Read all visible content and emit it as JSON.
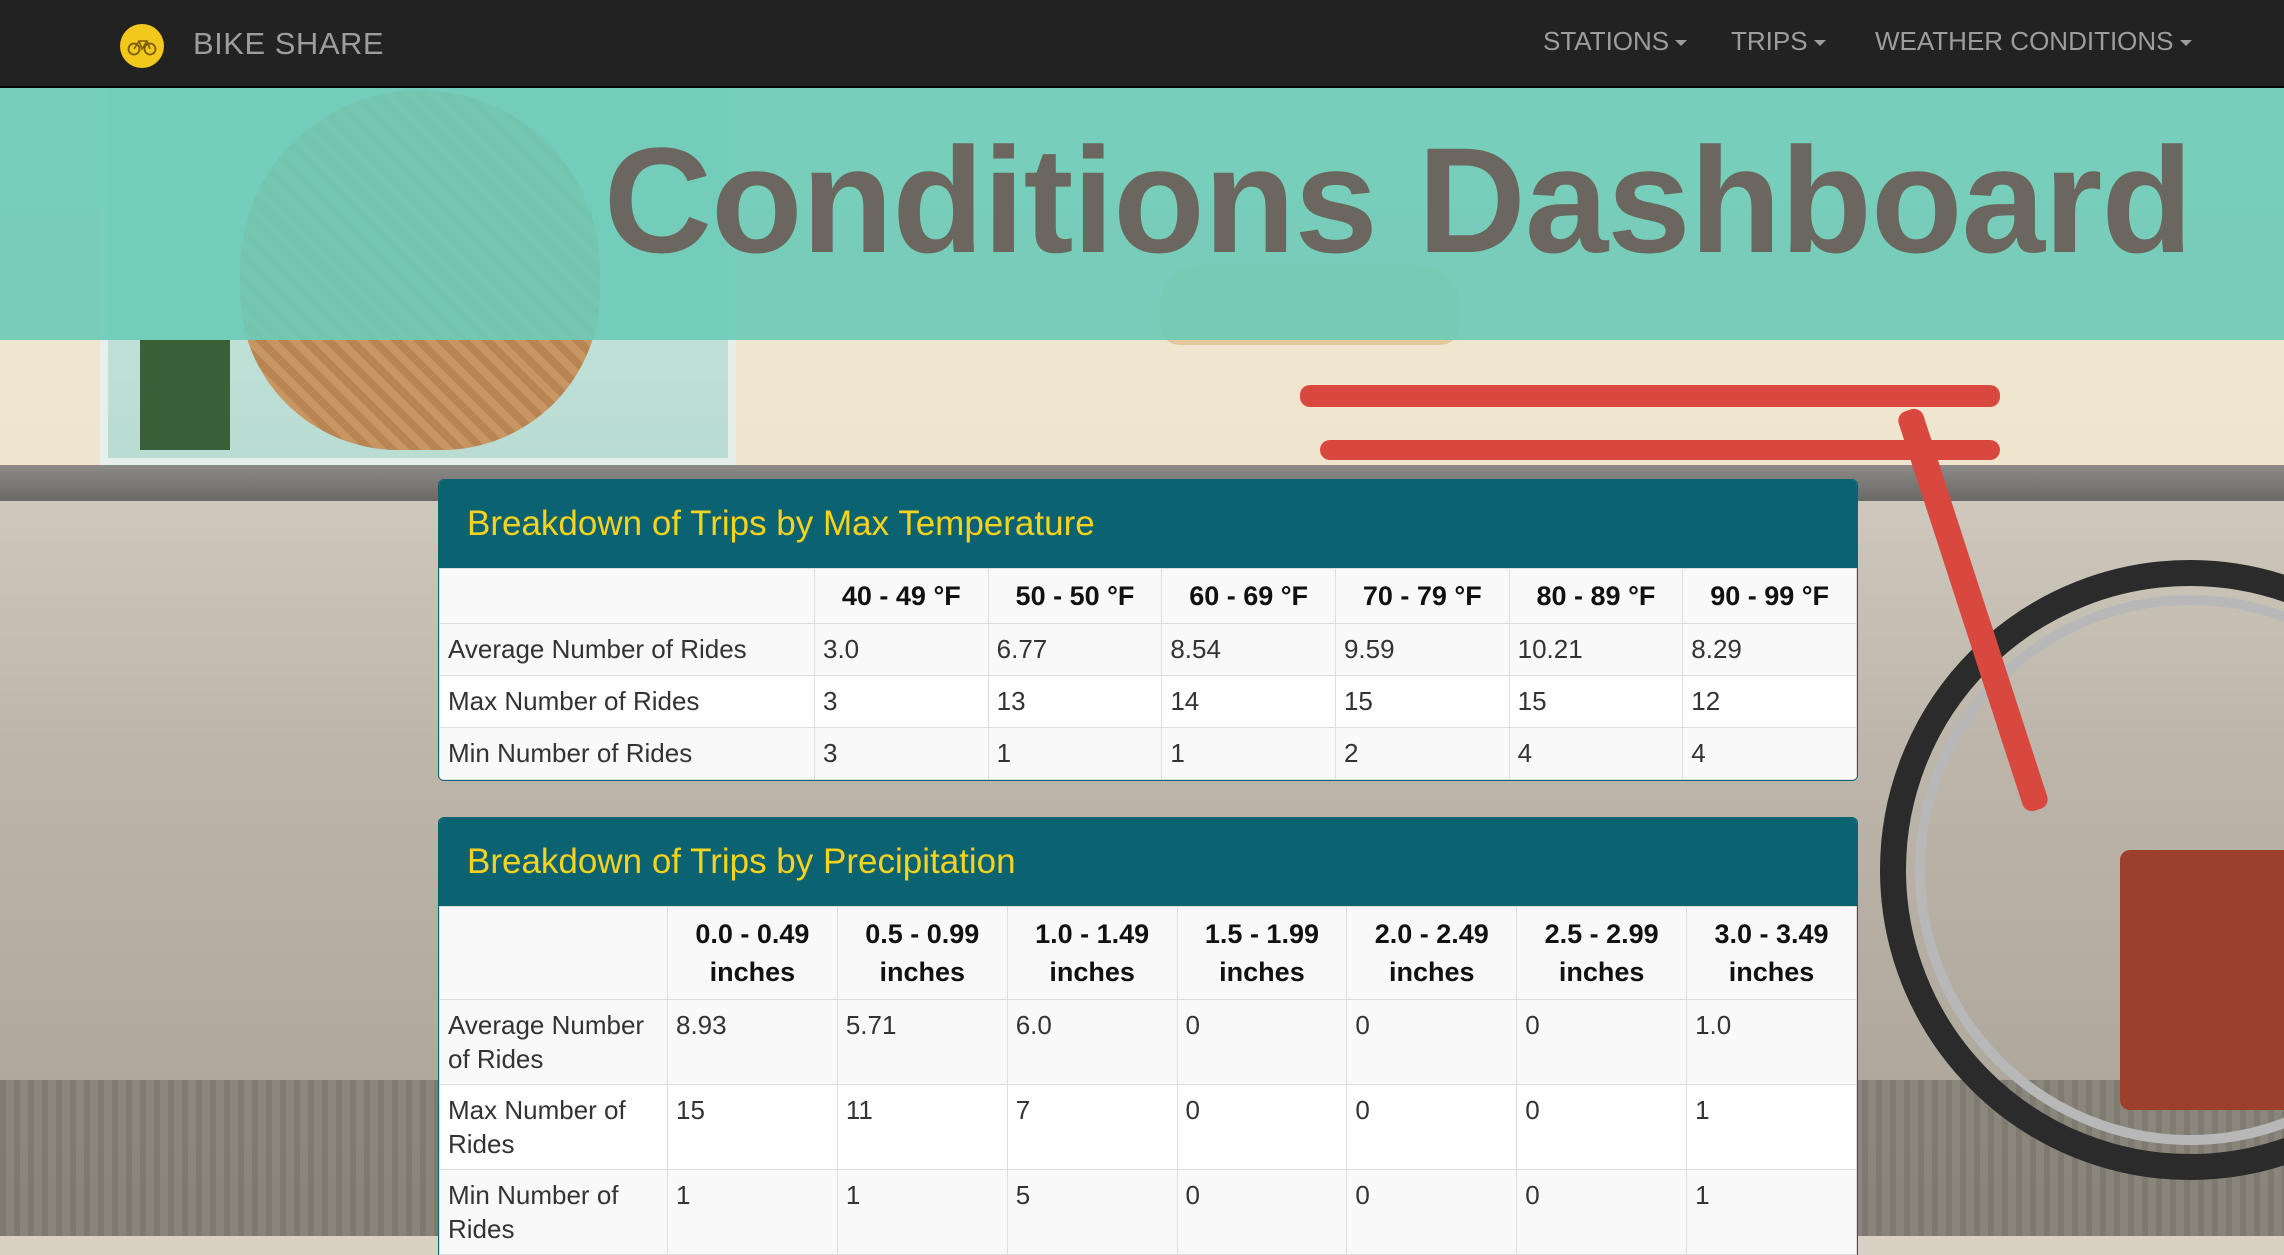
{
  "navbar": {
    "brand": "BIKE SHARE",
    "items": [
      {
        "label": "STATIONS"
      },
      {
        "label": "TRIPS"
      },
      {
        "label": "WEATHER CONDITIONS"
      }
    ]
  },
  "header": {
    "title": "Conditions Dashboard"
  },
  "colors": {
    "navbar_bg": "#222222",
    "banner": "#6ccbb7",
    "panel_heading_bg": "#0b6270",
    "panel_heading_text": "#f7d21e",
    "logo": "#f2c81c"
  },
  "temperature_table": {
    "title": "Breakdown of Trips by Max Temperature",
    "columns": [
      "",
      "40 - 49 °F",
      "50 - 50 °F",
      "60 - 69 °F",
      "70 - 79 °F",
      "80 - 89 °F",
      "90 - 99 °F"
    ],
    "rows": [
      {
        "label": "Average Number of Rides",
        "values": [
          "3.0",
          "6.77",
          "8.54",
          "9.59",
          "10.21",
          "8.29"
        ]
      },
      {
        "label": "Max Number of Rides",
        "values": [
          "3",
          "13",
          "14",
          "15",
          "15",
          "12"
        ]
      },
      {
        "label": "Min Number of Rides",
        "values": [
          "3",
          "1",
          "1",
          "2",
          "4",
          "4"
        ]
      }
    ]
  },
  "precipitation_table": {
    "title": "Breakdown of Trips by Precipitation",
    "columns": [
      "",
      "0.0 - 0.49 inches",
      "0.5 - 0.99 inches",
      "1.0 - 1.49 inches",
      "1.5 - 1.99 inches",
      "2.0 - 2.49 inches",
      "2.5 - 2.99 inches",
      "3.0 - 3.49 inches"
    ],
    "rows": [
      {
        "label": "Average Number of Rides",
        "values": [
          "8.93",
          "5.71",
          "6.0",
          "0",
          "0",
          "0",
          "1.0"
        ]
      },
      {
        "label": "Max Number of Rides",
        "values": [
          "15",
          "11",
          "7",
          "0",
          "0",
          "0",
          "1"
        ]
      },
      {
        "label": "Min Number of Rides",
        "values": [
          "1",
          "1",
          "5",
          "0",
          "0",
          "0",
          "1"
        ]
      }
    ]
  }
}
